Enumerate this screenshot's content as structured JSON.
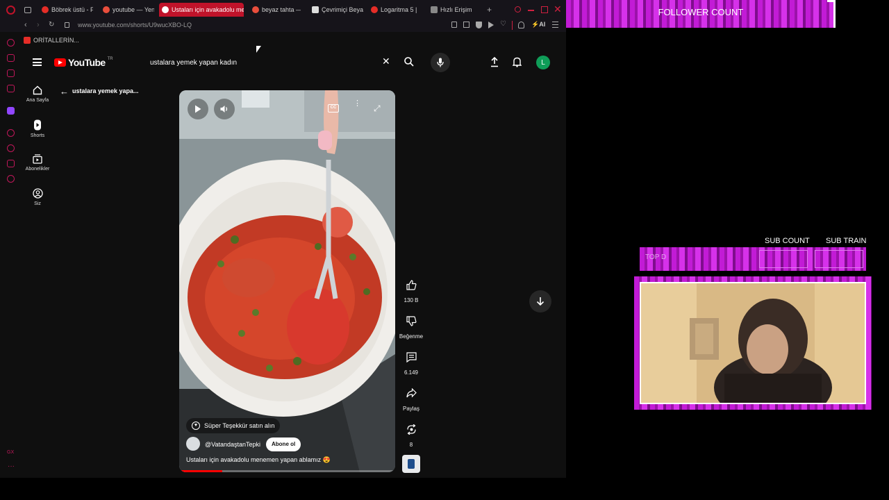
{
  "browser": {
    "tabs": [
      {
        "label": "Böbrek üstü - F",
        "icon": "youtube-favicon",
        "color": "#e52d27"
      },
      {
        "label": "youtube — Yen",
        "icon": "yandex-favicon",
        "color": "#e94e3c"
      },
      {
        "label": "Ustaları için avakadolu me",
        "icon": "youtube-favicon",
        "color": "#ffffff",
        "active": true
      },
      {
        "label": "beyaz tahta —",
        "icon": "yandex-favicon",
        "color": "#e94e3c"
      },
      {
        "label": "Çevrimiçi Beya",
        "icon": "whiteboard-favicon",
        "color": "#dddddd"
      },
      {
        "label": "Logaritma 5 |",
        "icon": "youtube-favicon",
        "color": "#e52d27"
      },
      {
        "label": "Hızlı Erişim",
        "icon": "grid-favicon",
        "color": "#aaaaaa"
      }
    ],
    "url": "www.youtube.com/shorts/U9wucXBO-LQ",
    "bookmark": "ORİTALLERİN...",
    "ai_label": "AI"
  },
  "youtube": {
    "logo_text": "YouTube",
    "region": "TR",
    "search_value": "ustalara yemek yapan kadın",
    "avatar_letter": "L",
    "avatar_color": "#0f9d58",
    "back_title": "ustalara yemek yapa...",
    "nav": [
      {
        "label": "Ana Sayfa",
        "icon": "home-icon"
      },
      {
        "label": "Shorts",
        "icon": "shorts-icon"
      },
      {
        "label": "Abonelikler",
        "icon": "subscriptions-icon"
      },
      {
        "label": "Siz",
        "icon": "account-icon"
      }
    ],
    "short": {
      "thanks": "Süper Teşekkür satın alın",
      "channel": "@VatandaştanTepki",
      "subscribe": "Abone ol",
      "caption": "Ustaları için avakadolu menemen yapan ablamız 😍",
      "progress": 0.2
    },
    "actions": {
      "likes": "130 B",
      "dislike": "Beğenme",
      "comments": "6.149",
      "share": "Paylaş",
      "remix": "8"
    }
  },
  "overlay": {
    "follower": "FOLLOWER COUNT",
    "sub_count": "SUB COUNT",
    "sub_train": "SUB TRAIN",
    "top_label": "TOP D",
    "accent": "#c21bd6"
  }
}
